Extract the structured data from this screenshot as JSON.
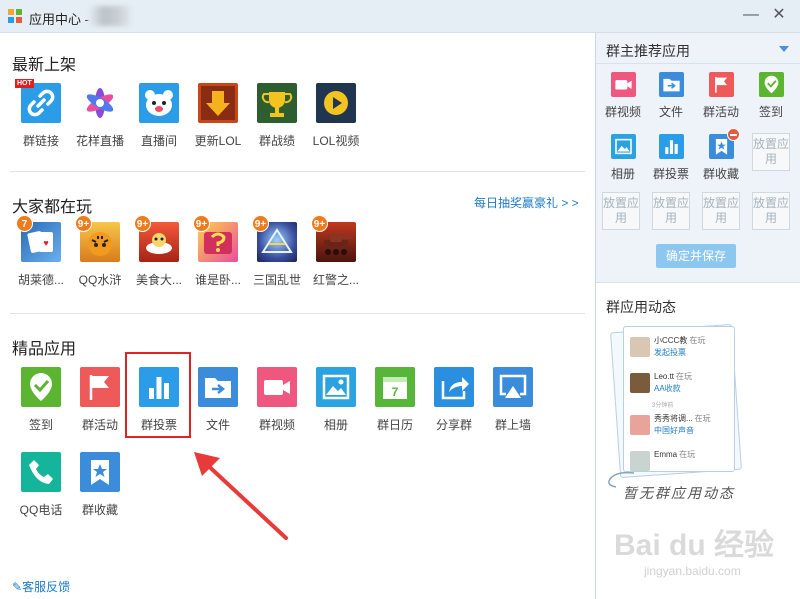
{
  "window": {
    "title": "应用中心 -",
    "minimize_glyph": "—",
    "close_glyph": "✕"
  },
  "sections": {
    "new": {
      "title": "最新上架",
      "items": [
        {
          "label": "群链接",
          "icon": "link-icon",
          "color": "#2b9de8",
          "badge": "HOT"
        },
        {
          "label": "花样直播",
          "icon": "flower-star-icon",
          "color": "#ffffff"
        },
        {
          "label": "直播间",
          "icon": "bear-icon",
          "color": "#2b9de8"
        },
        {
          "label": "更新LOL",
          "icon": "download-arrow-icon",
          "color": "#c7471b"
        },
        {
          "label": "群战绩",
          "icon": "trophy-icon",
          "color": "#2e5e2f"
        },
        {
          "label": "LOL视频",
          "icon": "play-icon",
          "color": "#203550"
        }
      ]
    },
    "popular": {
      "title": "大家都在玩",
      "link": "每日抽奖赢豪礼 > >",
      "items": [
        {
          "label": "胡莱德...",
          "icon": "game-poker-icon",
          "color": "#2a6bb5",
          "badge": "7"
        },
        {
          "label": "QQ水浒",
          "icon": "game-tiger-icon",
          "color": "#e8a52b",
          "badge": "9+"
        },
        {
          "label": "美食大...",
          "icon": "game-food-icon",
          "color": "#d83a2a",
          "badge": "9+"
        },
        {
          "label": "谁是卧...",
          "icon": "game-whois-icon",
          "color": "#e64da0",
          "badge": "9+"
        },
        {
          "label": "三国乱世",
          "icon": "game-sanguo-icon",
          "color": "#3a4fa0",
          "badge": "9+"
        },
        {
          "label": "红警之...",
          "icon": "game-redalert-icon",
          "color": "#9a2a1a",
          "badge": "9+"
        }
      ]
    },
    "featured": {
      "title": "精品应用",
      "items": [
        {
          "label": "签到",
          "icon": "checkin-icon",
          "color": "#5cb531"
        },
        {
          "label": "群活动",
          "icon": "flag-icon",
          "color": "#ee5a5a"
        },
        {
          "label": "群投票",
          "icon": "bar-chart-icon",
          "color": "#2b9de8"
        },
        {
          "label": "文件",
          "icon": "folder-icon",
          "color": "#3b8ddb"
        },
        {
          "label": "群视频",
          "icon": "video-icon",
          "color": "#f0577f"
        },
        {
          "label": "相册",
          "icon": "image-icon",
          "color": "#2ba3e0"
        },
        {
          "label": "群日历",
          "icon": "calendar-icon",
          "color": "#57b53a"
        },
        {
          "label": "分享群",
          "icon": "share-icon",
          "color": "#2b8fe0"
        },
        {
          "label": "群上墙",
          "icon": "screen-cast-icon",
          "color": "#3b8ddb"
        },
        {
          "label": "QQ电话",
          "icon": "phone-icon",
          "color": "#14b59a"
        },
        {
          "label": "群收藏",
          "icon": "bookmark-star-icon",
          "color": "#3b8ddb"
        }
      ]
    }
  },
  "feedback": "客服反馈",
  "sidebar": {
    "recommend_title": "群主推荐应用",
    "apps": [
      {
        "label": "群视频",
        "icon": "video-icon",
        "color": "#f0577f"
      },
      {
        "label": "文件",
        "icon": "folder-icon",
        "color": "#3b8ddb"
      },
      {
        "label": "群活动",
        "icon": "flag-icon",
        "color": "#ee5a5a"
      },
      {
        "label": "签到",
        "icon": "checkin-icon",
        "color": "#5cb531"
      },
      {
        "label": "相册",
        "icon": "image-icon",
        "color": "#2ba3e0"
      },
      {
        "label": "群投票",
        "icon": "bar-chart-icon",
        "color": "#2b9de8"
      },
      {
        "label": "群收藏",
        "icon": "bookmark-star-icon",
        "color": "#3b8ddb"
      }
    ],
    "slot_label": "放置应用",
    "confirm": "确定并保存",
    "dynamics_title": "群应用动态",
    "feed": [
      {
        "name": "小CCC教",
        "verb": "在玩",
        "action": "发起投票"
      },
      {
        "name": "Leo.tt",
        "verb": "在玩",
        "action": "AA收款"
      },
      {
        "name": "秀秀将调...",
        "verb": "在玩",
        "action": "中国好声音"
      },
      {
        "name": "Emma",
        "verb": "在玩",
        "action": ""
      }
    ],
    "feed_time": "3分钟前",
    "empty_text": "暂无群应用动态"
  },
  "watermark": {
    "brand": "Bai du 经验",
    "url": "jingyan.baidu.com"
  }
}
